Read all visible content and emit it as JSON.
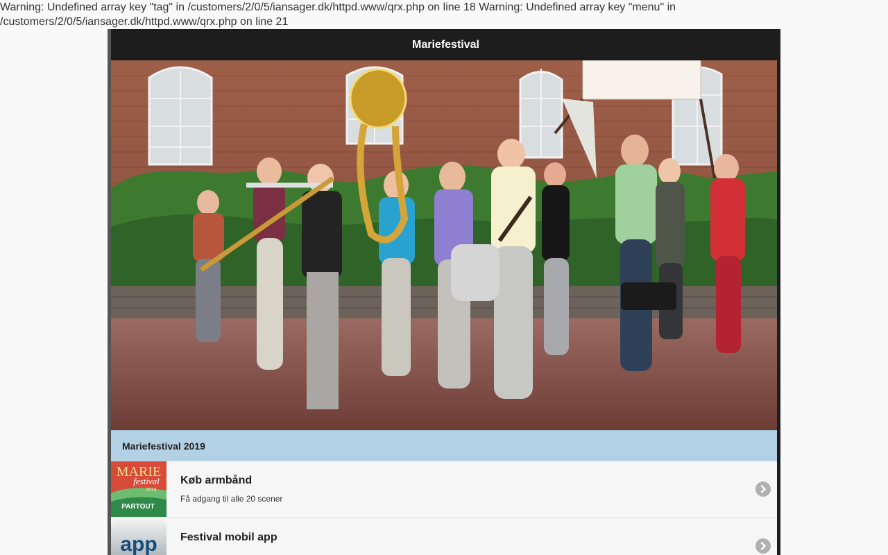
{
  "warning": {
    "text": "Warning: Undefined array key \"tag\" in /customers/2/0/5/iansager.dk/httpd.www/qrx.php on line 18 Warning: Undefined array key \"menu\" in /customers/2/0/5/iansager.dk/httpd.www/qrx.php on line 21"
  },
  "header": {
    "title": "Mariefestival"
  },
  "section": {
    "title": "Mariefestival 2019"
  },
  "items": [
    {
      "title": "Køb armbånd",
      "description": "Få adgang til alle 20 scener",
      "thumb": {
        "top_text": "MARIE",
        "script_text": "festival",
        "year": "2014",
        "bottom_text": "PARTOUT"
      },
      "icon": "chevron-right-icon"
    },
    {
      "title": "Festival mobil app",
      "description": "",
      "thumb": {
        "text": "app"
      },
      "icon": "chevron-right-icon"
    }
  ],
  "colors": {
    "header_bg": "#1d1d1d",
    "section_bg": "#b3d1e4",
    "list_bg": "#f6f6f6",
    "chevron_bg": "#b0b0b0"
  }
}
